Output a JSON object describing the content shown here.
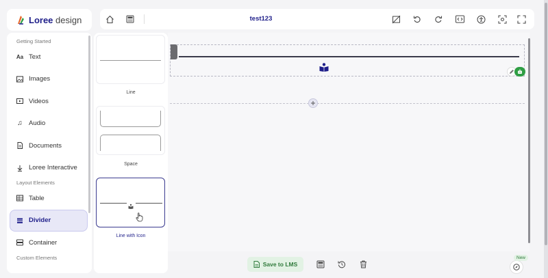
{
  "app": {
    "name_bold": "Loree",
    "name_light": " design"
  },
  "toolbar": {
    "doc_title": "test123"
  },
  "sidebar": {
    "sections": [
      {
        "label": "Getting Started"
      },
      {
        "label": "Layout Elements"
      },
      {
        "label": "Custom Elements"
      }
    ],
    "items": [
      {
        "label": "Text",
        "icon": "text-icon"
      },
      {
        "label": "Images",
        "icon": "image-icon"
      },
      {
        "label": "Videos",
        "icon": "video-icon"
      },
      {
        "label": "Audio",
        "icon": "music-icon"
      },
      {
        "label": "Documents",
        "icon": "document-icon"
      },
      {
        "label": "Loree Interactive",
        "icon": "interactive-icon"
      },
      {
        "label": "Table",
        "icon": "table-icon"
      },
      {
        "label": "Divider",
        "icon": "divider-icon",
        "active": true
      },
      {
        "label": "Container",
        "icon": "container-icon"
      }
    ]
  },
  "picker": {
    "options": [
      {
        "label": "Line"
      },
      {
        "label": "Space"
      },
      {
        "label": "Line with Icon",
        "selected": true
      }
    ]
  },
  "bottom": {
    "save_label": "Save to LMS",
    "new_badge": "New"
  },
  "colors": {
    "brand": "#1f1f8a",
    "accent_green": "#2f9e44",
    "active_bg": "#e8e8f7"
  }
}
